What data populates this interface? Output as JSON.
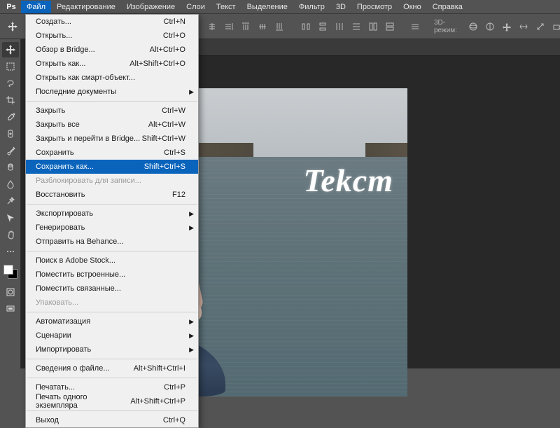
{
  "logo": "Ps",
  "menubar": [
    "Файл",
    "Редактирование",
    "Изображение",
    "Слои",
    "Текст",
    "Выделение",
    "Фильтр",
    "3D",
    "Просмотр",
    "Окно",
    "Справка"
  ],
  "menubar_open_index": 0,
  "optbar": {
    "mode_label": "3D-режим:"
  },
  "dropdown": {
    "groups": [
      [
        {
          "label": "Создать...",
          "shortcut": "Ctrl+N",
          "sub": false,
          "disabled": false
        },
        {
          "label": "Открыть...",
          "shortcut": "Ctrl+O",
          "sub": false,
          "disabled": false
        },
        {
          "label": "Обзор в Bridge...",
          "shortcut": "Alt+Ctrl+O",
          "sub": false,
          "disabled": false
        },
        {
          "label": "Открыть как...",
          "shortcut": "Alt+Shift+Ctrl+O",
          "sub": false,
          "disabled": false
        },
        {
          "label": "Открыть как смарт-объект...",
          "shortcut": "",
          "sub": false,
          "disabled": false
        },
        {
          "label": "Последние документы",
          "shortcut": "",
          "sub": true,
          "disabled": false
        }
      ],
      [
        {
          "label": "Закрыть",
          "shortcut": "Ctrl+W",
          "sub": false,
          "disabled": false
        },
        {
          "label": "Закрыть все",
          "shortcut": "Alt+Ctrl+W",
          "sub": false,
          "disabled": false
        },
        {
          "label": "Закрыть и перейти в Bridge...",
          "shortcut": "Shift+Ctrl+W",
          "sub": false,
          "disabled": false
        },
        {
          "label": "Сохранить",
          "shortcut": "Ctrl+S",
          "sub": false,
          "disabled": false
        },
        {
          "label": "Сохранить как...",
          "shortcut": "Shift+Ctrl+S",
          "sub": false,
          "disabled": false,
          "highlight": true
        },
        {
          "label": "Разблокировать для записи...",
          "shortcut": "",
          "sub": false,
          "disabled": true
        },
        {
          "label": "Восстановить",
          "shortcut": "F12",
          "sub": false,
          "disabled": false
        }
      ],
      [
        {
          "label": "Экспортировать",
          "shortcut": "",
          "sub": true,
          "disabled": false
        },
        {
          "label": "Генерировать",
          "shortcut": "",
          "sub": true,
          "disabled": false
        },
        {
          "label": "Отправить на Behance...",
          "shortcut": "",
          "sub": false,
          "disabled": false
        }
      ],
      [
        {
          "label": "Поиск в Adobe Stock...",
          "shortcut": "",
          "sub": false,
          "disabled": false
        },
        {
          "label": "Поместить встроенные...",
          "shortcut": "",
          "sub": false,
          "disabled": false
        },
        {
          "label": "Поместить связанные...",
          "shortcut": "",
          "sub": false,
          "disabled": false
        },
        {
          "label": "Упаковать...",
          "shortcut": "",
          "sub": false,
          "disabled": true
        }
      ],
      [
        {
          "label": "Автоматизация",
          "shortcut": "",
          "sub": true,
          "disabled": false
        },
        {
          "label": "Сценарии",
          "shortcut": "",
          "sub": true,
          "disabled": false
        },
        {
          "label": "Импортировать",
          "shortcut": "",
          "sub": true,
          "disabled": false
        }
      ],
      [
        {
          "label": "Сведения о файле...",
          "shortcut": "Alt+Shift+Ctrl+I",
          "sub": false,
          "disabled": false
        }
      ],
      [
        {
          "label": "Печатать...",
          "shortcut": "Ctrl+P",
          "sub": false,
          "disabled": false
        },
        {
          "label": "Печать одного экземпляра",
          "shortcut": "Alt+Shift+Ctrl+P",
          "sub": false,
          "disabled": false
        }
      ],
      [
        {
          "label": "Выход",
          "shortcut": "Ctrl+Q",
          "sub": false,
          "disabled": false
        }
      ]
    ]
  },
  "canvas_text": "Tekcm",
  "tools": [
    "move",
    "marquee",
    "lasso",
    "crop",
    "eyedropper",
    "healing",
    "brush",
    "eraser",
    "bucket",
    "blur",
    "type",
    "pen",
    "path",
    "hand"
  ]
}
